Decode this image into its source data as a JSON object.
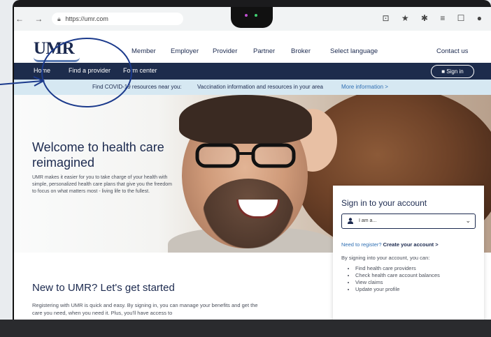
{
  "browser": {
    "url": "https://umr.com",
    "nav_glyphs": "← → C ⌂",
    "icons_text": "⊡ ★ ✱ ≡ ☐ ●"
  },
  "header": {
    "logo": "UMR",
    "nav": [
      "Member",
      "Employer",
      "Provider",
      "Partner",
      "Broker",
      "Select language"
    ],
    "contact": "Contact us"
  },
  "navbar": {
    "items": [
      "Home",
      "Find a provider",
      "Form center"
    ],
    "signin": "Sign in"
  },
  "banner": {
    "lead": "Find COVID-19 resources near you:",
    "text": "Vaccination information and resources in your area",
    "link": "More information >"
  },
  "hero": {
    "title": "Welcome to health care reimagined",
    "body": "UMR makes it easier for you to take charge of your health with simple, personalized health care plans that give you the freedom to focus on what matters most - living life to the fullest."
  },
  "signin_card": {
    "title": "Sign in to your account",
    "select_value": "I am a...",
    "register_q": "Need to register?",
    "register_link": "Create your account >",
    "intro": "By signing into your account, you can:",
    "benefits": [
      "Find health care providers",
      "Check health care account balances",
      "View claims",
      "Update your profile"
    ]
  },
  "lower": {
    "title": "New to UMR? Let's get started",
    "body": "Registering with UMR is quick and easy. By signing in, you can manage your benefits and get the care you need, when you need it. Plus, you'll have access to"
  },
  "colors": {
    "navy": "#1d2c4c",
    "banner": "#d6e8f2",
    "link": "#2f6fb3",
    "annotation": "#1b3a8c"
  }
}
